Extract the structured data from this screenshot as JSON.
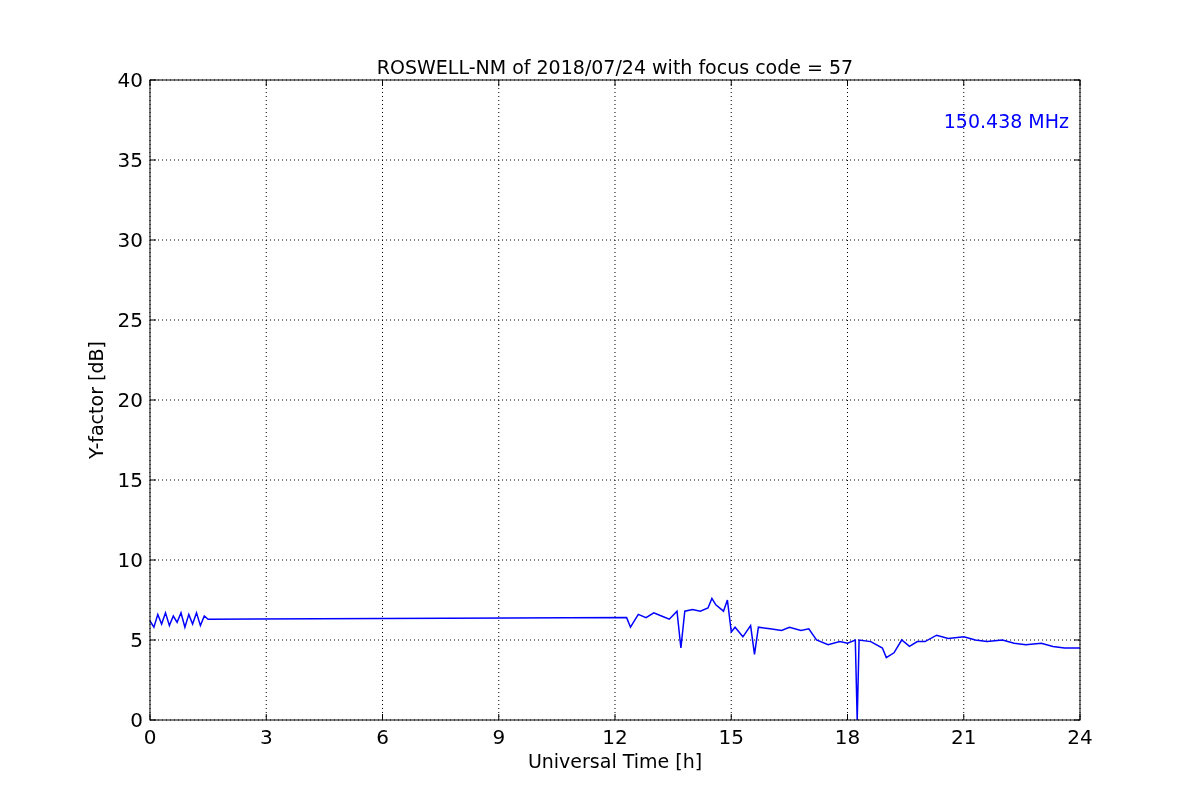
{
  "chart_data": {
    "type": "line",
    "title": "ROSWELL-NM of 2018/07/24 with focus code = 57",
    "xlabel": "Universal Time [h]",
    "ylabel": "Y-factor [dB]",
    "grid": true,
    "xlim": [
      0,
      24
    ],
    "ylim": [
      0,
      40
    ],
    "xticks": [
      0,
      3,
      6,
      9,
      12,
      15,
      18,
      21,
      24
    ],
    "yticks": [
      0,
      5,
      10,
      15,
      20,
      25,
      30,
      35,
      40
    ],
    "x": [
      0,
      0.1,
      0.2,
      0.3,
      0.4,
      0.5,
      0.6,
      0.7,
      0.8,
      0.9,
      1.0,
      1.1,
      1.2,
      1.3,
      1.4,
      1.5,
      12.3,
      12.4,
      12.6,
      12.8,
      13.0,
      13.2,
      13.4,
      13.6,
      13.7,
      13.8,
      14.0,
      14.2,
      14.4,
      14.5,
      14.6,
      14.8,
      14.9,
      15.0,
      15.1,
      15.3,
      15.5,
      15.6,
      15.7,
      16.0,
      16.3,
      16.5,
      16.8,
      17.0,
      17.2,
      17.5,
      17.8,
      18.0,
      18.2,
      18.25,
      18.3,
      18.6,
      18.9,
      19.0,
      19.2,
      19.4,
      19.6,
      19.8,
      20.0,
      20.3,
      20.6,
      21.0,
      21.3,
      21.6,
      22.0,
      22.3,
      22.6,
      23.0,
      23.3,
      23.6,
      24.0
    ],
    "series": [
      {
        "name": "150.438 MHz",
        "color": "#0000ff",
        "values": [
          6.2,
          5.8,
          6.6,
          6.0,
          6.7,
          5.9,
          6.5,
          6.1,
          6.7,
          5.8,
          6.6,
          6.0,
          6.7,
          5.9,
          6.5,
          6.3,
          6.4,
          5.8,
          6.6,
          6.4,
          6.7,
          6.5,
          6.3,
          6.8,
          4.5,
          6.8,
          6.9,
          6.8,
          7.0,
          7.6,
          7.2,
          6.8,
          7.5,
          5.5,
          5.8,
          5.2,
          5.9,
          4.1,
          5.8,
          5.7,
          5.6,
          5.8,
          5.6,
          5.7,
          5.0,
          4.7,
          4.9,
          4.8,
          5.0,
          0,
          5.0,
          4.9,
          4.5,
          3.9,
          4.2,
          5.0,
          4.6,
          4.9,
          4.9,
          5.3,
          5.1,
          5.2,
          5.0,
          4.9,
          5.0,
          4.8,
          4.7,
          4.8,
          4.6,
          4.5,
          4.5
        ]
      }
    ]
  }
}
